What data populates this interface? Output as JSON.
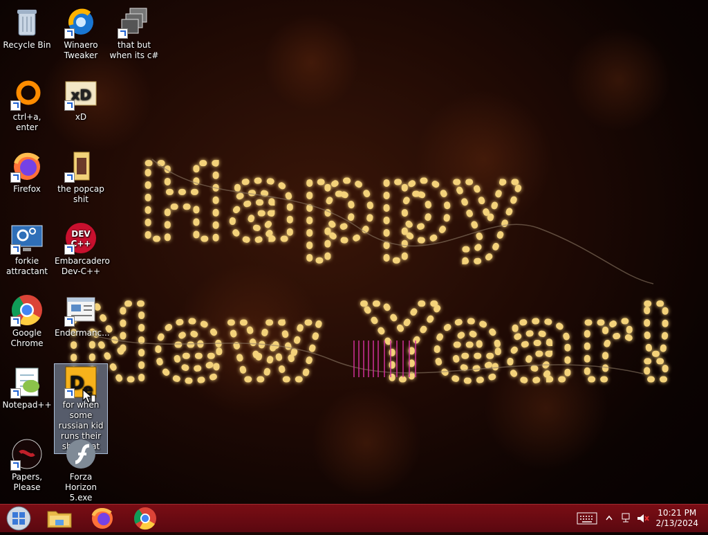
{
  "wallpaper": {
    "line1": "Happy",
    "line2": "New Year!"
  },
  "desktop_icons": [
    {
      "label": "Recycle Bin",
      "icon": "recycle-bin-icon"
    },
    {
      "label": "Winaero Tweaker",
      "icon": "winaero-tweaker-icon"
    },
    {
      "label": "that but when its c#",
      "icon": "windows-stack-icon"
    },
    {
      "label": "ctrl+a, enter",
      "icon": "orange-ring-icon"
    },
    {
      "label": "xD",
      "icon": "hxd-icon"
    },
    {
      "label": "Firefox",
      "icon": "firefox-icon"
    },
    {
      "label": "the popcap shit",
      "icon": "folder-icon"
    },
    {
      "label": "forkie attractant",
      "icon": "monitor-gear-icon"
    },
    {
      "label": "Embarcadero Dev-C++",
      "icon": "devcpp-icon"
    },
    {
      "label": "Google Chrome",
      "icon": "chrome-icon"
    },
    {
      "label": "Endermanc...",
      "icon": "window-app-icon"
    },
    {
      "label": "Notepad++",
      "icon": "notepadpp-icon"
    },
    {
      "label": "for when some russian kid runs their shitty rat",
      "icon": "die-icon"
    },
    {
      "label": "Papers, Please",
      "icon": "papers-please-icon"
    },
    {
      "label": "Forza Horizon 5.exe",
      "icon": "flash-icon"
    }
  ],
  "taskbar": {
    "start": "start-button",
    "pinned": [
      "file-explorer-icon",
      "firefox-icon",
      "chrome-icon"
    ],
    "tray": {
      "time": "10:21 PM",
      "date": "2/13/2024"
    },
    "colors": {
      "taskbar": "#6a0b12"
    }
  }
}
